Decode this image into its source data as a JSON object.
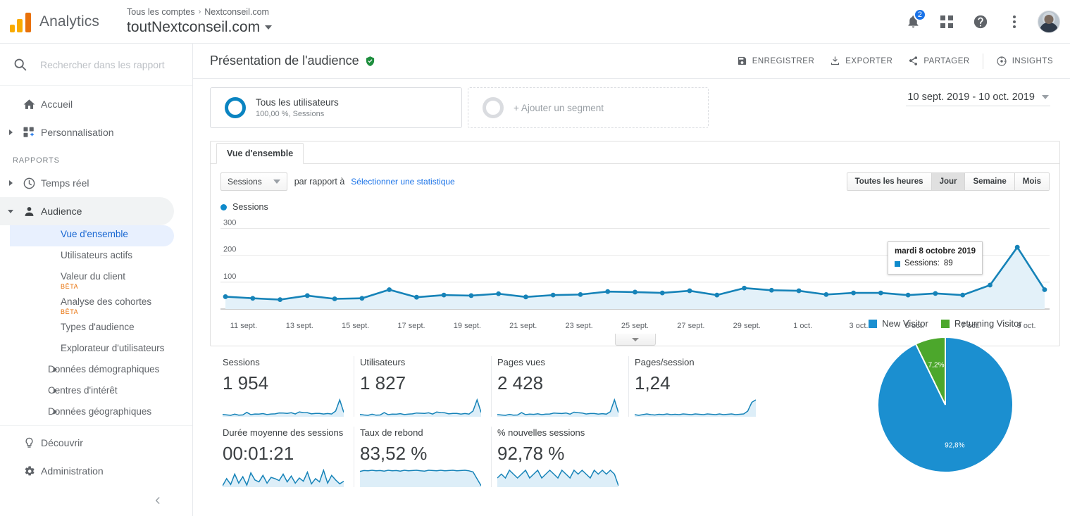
{
  "brand": {
    "name": "Analytics",
    "logo_icon": "analytics-logo-icon"
  },
  "account": {
    "breadcrumb_all": "Tous les comptes",
    "breadcrumb_sep": "›",
    "breadcrumb_property": "Nextconseil.com",
    "title": "toutNextconseil.com"
  },
  "topbar": {
    "notifications_count": "2",
    "bell_icon": "bell-icon",
    "apps_icon": "apps-grid-icon",
    "help_icon": "help-icon",
    "more_icon": "kebab-menu-icon",
    "avatar_icon": "user-avatar"
  },
  "sidebar": {
    "search_placeholder": "Rechercher dans les rapport",
    "search_value": "",
    "section_label": "RAPPORTS",
    "items": [
      {
        "label": "Accueil",
        "icon": "home-icon",
        "expandable": false
      },
      {
        "label": "Personnalisation",
        "icon": "customization-icon",
        "expandable": true
      },
      {
        "label": "Temps réel",
        "icon": "clock-icon",
        "expandable": true
      },
      {
        "label": "Audience",
        "icon": "person-icon",
        "expandable": true,
        "expanded": true,
        "active": true
      }
    ],
    "audience_children": [
      {
        "label": "Vue d'ensemble",
        "selected": true
      },
      {
        "label": "Utilisateurs actifs"
      },
      {
        "label": "Valeur du client",
        "beta": "BÊTA"
      },
      {
        "label": "Analyse des cohortes",
        "beta": "BÊTA"
      },
      {
        "label": "Types d'audience"
      },
      {
        "label": "Explorateur d'utilisateurs"
      },
      {
        "label": "Données démographiques",
        "arrow": true
      },
      {
        "label": "Centres d'intérêt",
        "arrow": true
      },
      {
        "label": "Données géographiques",
        "arrow": true
      }
    ],
    "bottom_items": [
      {
        "label": "Découvrir",
        "icon": "bulb-icon"
      },
      {
        "label": "Administration",
        "icon": "gear-icon"
      }
    ],
    "collapse_icon": "chevron-left-icon"
  },
  "header": {
    "page_title": "Présentation de l'audience",
    "verified_icon": "verified-shield-icon",
    "actions": [
      {
        "label": "ENREGISTRER",
        "icon": "save-icon"
      },
      {
        "label": "EXPORTER",
        "icon": "download-icon"
      },
      {
        "label": "PARTAGER",
        "icon": "share-icon"
      },
      {
        "label": "INSIGHTS",
        "icon": "insights-icon"
      }
    ]
  },
  "segments": {
    "primary_title": "Tous les utilisateurs",
    "primary_sub": "100,00 %, Sessions",
    "add_label": "+ Ajouter un segment"
  },
  "date_range": {
    "value": "10 sept. 2019 - 10 oct. 2019",
    "caret_icon": "chevron-down-icon"
  },
  "panel": {
    "tab_label": "Vue d'ensemble",
    "metric_select": "Sessions",
    "compare_text": "par rapport à",
    "compare_link": "Sélectionner une statistique",
    "granularity": [
      {
        "label": "Toutes les heures",
        "selected": false
      },
      {
        "label": "Jour",
        "selected": true
      },
      {
        "label": "Semaine",
        "selected": false
      },
      {
        "label": "Mois",
        "selected": false
      }
    ],
    "series_legend": "Sessions",
    "expand_icon": "chevron-down-icon"
  },
  "tooltip": {
    "date": "mardi 8 octobre 2019",
    "metric_label": "Sessions:",
    "metric_value": "89"
  },
  "metrics_row1": [
    {
      "label": "Sessions",
      "value": "1 954"
    },
    {
      "label": "Utilisateurs",
      "value": "1 827"
    },
    {
      "label": "Pages vues",
      "value": "2 428"
    },
    {
      "label": "Pages/session",
      "value": "1,24"
    }
  ],
  "metrics_row2": [
    {
      "label": "Durée moyenne des sessions",
      "value": "00:01:21"
    },
    {
      "label": "Taux de rebond",
      "value": "83,52 %"
    },
    {
      "label": "% nouvelles sessions",
      "value": "92,78 %"
    }
  ],
  "colors": {
    "accent_blue": "#0f8acb",
    "link_blue": "#1a73e8",
    "new_visitor": "#1b8fd0",
    "returning_visitor": "#4ca72c",
    "beta_orange": "#e8710a",
    "verified_green": "#1e8e3e"
  },
  "chart_data": [
    {
      "type": "line",
      "title": "Sessions",
      "xlabel": "",
      "ylabel": "Sessions",
      "ylim": [
        0,
        330
      ],
      "yticks": [
        100,
        200,
        300
      ],
      "grid": true,
      "legend": [
        "Sessions"
      ],
      "annotation": {
        "date": "mardi 8 octobre 2019",
        "value": 89
      },
      "x": [
        "10 sept.",
        "11 sept.",
        "12 sept.",
        "13 sept.",
        "14 sept.",
        "15 sept.",
        "16 sept.",
        "17 sept.",
        "18 sept.",
        "19 sept.",
        "20 sept.",
        "21 sept.",
        "22 sept.",
        "23 sept.",
        "24 sept.",
        "25 sept.",
        "26 sept.",
        "27 sept.",
        "28 sept.",
        "29 sept.",
        "30 sept.",
        "1 oct.",
        "2 oct.",
        "3 oct.",
        "4 oct.",
        "5 oct.",
        "6 oct.",
        "7 oct.",
        "8 oct.",
        "9 oct.",
        "10 oct."
      ],
      "tick_labels": [
        "11 sept.",
        "13 sept.",
        "15 sept.",
        "17 sept.",
        "19 sept.",
        "21 sept.",
        "23 sept.",
        "25 sept.",
        "27 sept.",
        "29 sept.",
        "1 oct.",
        "3 oct.",
        "5 oct.",
        "7 oct.",
        "9 oct."
      ],
      "values": [
        46,
        40,
        35,
        50,
        38,
        40,
        72,
        44,
        52,
        50,
        57,
        45,
        52,
        54,
        65,
        63,
        60,
        68,
        52,
        78,
        70,
        68,
        54,
        60,
        60,
        52,
        58,
        52,
        89,
        230,
        72
      ]
    },
    {
      "type": "pie",
      "title": "",
      "legend_position": "top",
      "labels": [
        "New Visitor",
        "Returning Visitor"
      ],
      "values": [
        92.8,
        7.2
      ],
      "value_labels": [
        "92,8%",
        "7,2%"
      ],
      "colors": [
        "#1b8fd0",
        "#4ca72c"
      ]
    },
    {
      "type": "line",
      "title": "Sessions sparkline",
      "values": [
        46,
        40,
        35,
        50,
        38,
        40,
        72,
        44,
        52,
        50,
        57,
        45,
        52,
        54,
        65,
        63,
        60,
        68,
        52,
        78,
        70,
        68,
        54,
        60,
        60,
        52,
        58,
        52,
        89,
        230,
        72
      ]
    },
    {
      "type": "line",
      "title": "Utilisateurs sparkline",
      "values": [
        44,
        38,
        34,
        47,
        36,
        38,
        66,
        42,
        49,
        47,
        54,
        43,
        49,
        51,
        61,
        59,
        57,
        64,
        49,
        73,
        66,
        64,
        51,
        57,
        57,
        49,
        55,
        49,
        84,
        215,
        68
      ]
    },
    {
      "type": "line",
      "title": "Pages vues sparkline",
      "values": [
        56,
        50,
        45,
        60,
        48,
        50,
        86,
        55,
        63,
        60,
        68,
        55,
        63,
        65,
        78,
        75,
        72,
        80,
        63,
        92,
        84,
        80,
        65,
        72,
        72,
        63,
        70,
        63,
        100,
        275,
        86
      ]
    },
    {
      "type": "line",
      "title": "Pages/session sparkline",
      "values": [
        1.2,
        1.18,
        1.2,
        1.22,
        1.2,
        1.19,
        1.21,
        1.2,
        1.22,
        1.2,
        1.21,
        1.2,
        1.22,
        1.21,
        1.2,
        1.22,
        1.21,
        1.2,
        1.22,
        1.21,
        1.2,
        1.22,
        1.2,
        1.21,
        1.22,
        1.2,
        1.21,
        1.22,
        1.3,
        1.55,
        1.62
      ]
    },
    {
      "type": "line",
      "title": "Durée moyenne des sessions sparkline",
      "values": [
        40,
        95,
        50,
        130,
        60,
        110,
        45,
        140,
        85,
        70,
        120,
        60,
        105,
        95,
        80,
        130,
        70,
        115,
        60,
        100,
        75,
        145,
        55,
        95,
        70,
        160,
        60,
        120,
        85,
        55,
        75
      ]
    },
    {
      "type": "line",
      "title": "Taux de rebond sparkline",
      "values": [
        82,
        85,
        84,
        86,
        84,
        85,
        83,
        86,
        84,
        85,
        83,
        86,
        84,
        85,
        86,
        84,
        83,
        86,
        85,
        84,
        86,
        84,
        85,
        86,
        84,
        85,
        86,
        84,
        80,
        55,
        30
      ]
    },
    {
      "type": "line",
      "title": "% nouvelles sessions sparkline",
      "values": [
        92,
        93,
        92,
        94,
        93,
        92,
        93,
        94,
        92,
        93,
        94,
        92,
        93,
        94,
        93,
        92,
        94,
        93,
        92,
        94,
        93,
        94,
        93,
        92,
        94,
        93,
        94,
        93,
        94,
        93,
        90
      ]
    }
  ]
}
